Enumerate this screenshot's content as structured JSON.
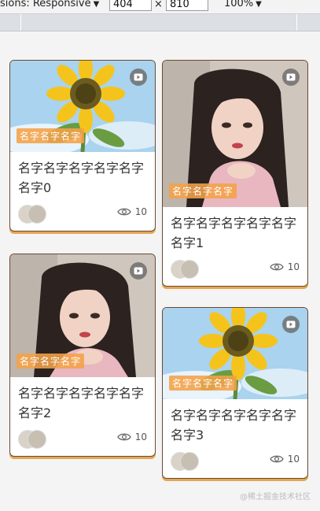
{
  "devtools": {
    "mode_label": "sions: Responsive",
    "width_value": "404",
    "height_value": "810",
    "times_symbol": "×",
    "zoom_label": "100%"
  },
  "cards": [
    {
      "tag": "名字名字名字",
      "title": "名字名字名字名字名字名字0",
      "views": "10",
      "image": "sunflower"
    },
    {
      "tag": "名字名字名字",
      "title": "名字名字名字名字名字名字1",
      "views": "10",
      "image": "portrait"
    },
    {
      "tag": "名字名字名字",
      "title": "名字名字名字名字名字名字2",
      "views": "10",
      "image": "portrait"
    },
    {
      "tag": "名字名字名字",
      "title": "名字名字名字名字名字名字3",
      "views": "10",
      "image": "sunflower"
    }
  ],
  "watermark": "@稀土掘金技术社区"
}
